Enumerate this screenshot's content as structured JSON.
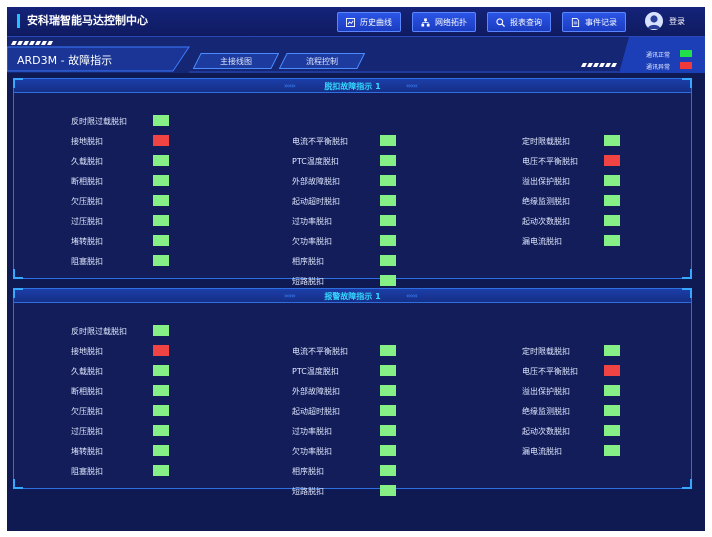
{
  "header": {
    "app_title": "安科瑞智能马达控制中心",
    "nav": [
      {
        "label": "历史曲线",
        "icon": "chart-icon"
      },
      {
        "label": "网络拓扑",
        "icon": "network-icon"
      },
      {
        "label": "报表查询",
        "icon": "search-icon"
      },
      {
        "label": "事件记录",
        "icon": "document-icon"
      }
    ],
    "login_label": "登录"
  },
  "page": {
    "title": "ARD3M - 故障指示",
    "tabs": [
      {
        "label": "主接线图"
      },
      {
        "label": "流程控制"
      }
    ],
    "legend": [
      {
        "label": "通讯正常",
        "color": "#22e04a"
      },
      {
        "label": "通讯异常",
        "color": "#f03a3a"
      }
    ]
  },
  "colors": {
    "normal": "#86ef86",
    "fault": "#f04444"
  },
  "panels": [
    {
      "title": "脱扣故障指示 1",
      "columns": [
        [
          {
            "label": "反时限过载脱扣",
            "state": "normal"
          },
          {
            "label": "接地脱扣",
            "state": "fault"
          },
          {
            "label": "久载脱扣",
            "state": "normal"
          },
          {
            "label": "断相脱扣",
            "state": "normal"
          },
          {
            "label": "欠压脱扣",
            "state": "normal"
          },
          {
            "label": "过压脱扣",
            "state": "normal"
          },
          {
            "label": "堵转脱扣",
            "state": "normal"
          },
          {
            "label": "阻塞脱扣",
            "state": "normal"
          }
        ],
        [
          {
            "label": "电流不平衡脱扣",
            "state": "normal"
          },
          {
            "label": "PTC温度脱扣",
            "state": "normal"
          },
          {
            "label": "外部故障脱扣",
            "state": "normal"
          },
          {
            "label": "起动超时脱扣",
            "state": "normal"
          },
          {
            "label": "过功率脱扣",
            "state": "normal"
          },
          {
            "label": "欠功率脱扣",
            "state": "normal"
          },
          {
            "label": "相序脱扣",
            "state": "normal"
          },
          {
            "label": "短路脱扣",
            "state": "normal"
          }
        ],
        [
          {
            "label": "定时限载脱扣",
            "state": "normal"
          },
          {
            "label": "电压不平衡脱扣",
            "state": "fault"
          },
          {
            "label": "溢出保护脱扣",
            "state": "normal"
          },
          {
            "label": "绝缘监测脱扣",
            "state": "normal"
          },
          {
            "label": "起动次数脱扣",
            "state": "normal"
          },
          {
            "label": "漏电流脱扣",
            "state": "normal"
          }
        ]
      ]
    },
    {
      "title": "报警故障指示 1",
      "columns": [
        [
          {
            "label": "反时限过载脱扣",
            "state": "normal"
          },
          {
            "label": "接地脱扣",
            "state": "fault"
          },
          {
            "label": "久载脱扣",
            "state": "normal"
          },
          {
            "label": "断相脱扣",
            "state": "normal"
          },
          {
            "label": "欠压脱扣",
            "state": "normal"
          },
          {
            "label": "过压脱扣",
            "state": "normal"
          },
          {
            "label": "堵转脱扣",
            "state": "normal"
          },
          {
            "label": "阻塞脱扣",
            "state": "normal"
          }
        ],
        [
          {
            "label": "电流不平衡脱扣",
            "state": "normal"
          },
          {
            "label": "PTC温度脱扣",
            "state": "normal"
          },
          {
            "label": "外部故障脱扣",
            "state": "normal"
          },
          {
            "label": "起动超时脱扣",
            "state": "normal"
          },
          {
            "label": "过功率脱扣",
            "state": "normal"
          },
          {
            "label": "欠功率脱扣",
            "state": "normal"
          },
          {
            "label": "相序脱扣",
            "state": "normal"
          },
          {
            "label": "短路脱扣",
            "state": "normal"
          }
        ],
        [
          {
            "label": "定时限载脱扣",
            "state": "normal"
          },
          {
            "label": "电压不平衡脱扣",
            "state": "fault"
          },
          {
            "label": "溢出保护脱扣",
            "state": "normal"
          },
          {
            "label": "绝缘监测脱扣",
            "state": "normal"
          },
          {
            "label": "起动次数脱扣",
            "state": "normal"
          },
          {
            "label": "漏电流脱扣",
            "state": "normal"
          }
        ]
      ]
    }
  ]
}
